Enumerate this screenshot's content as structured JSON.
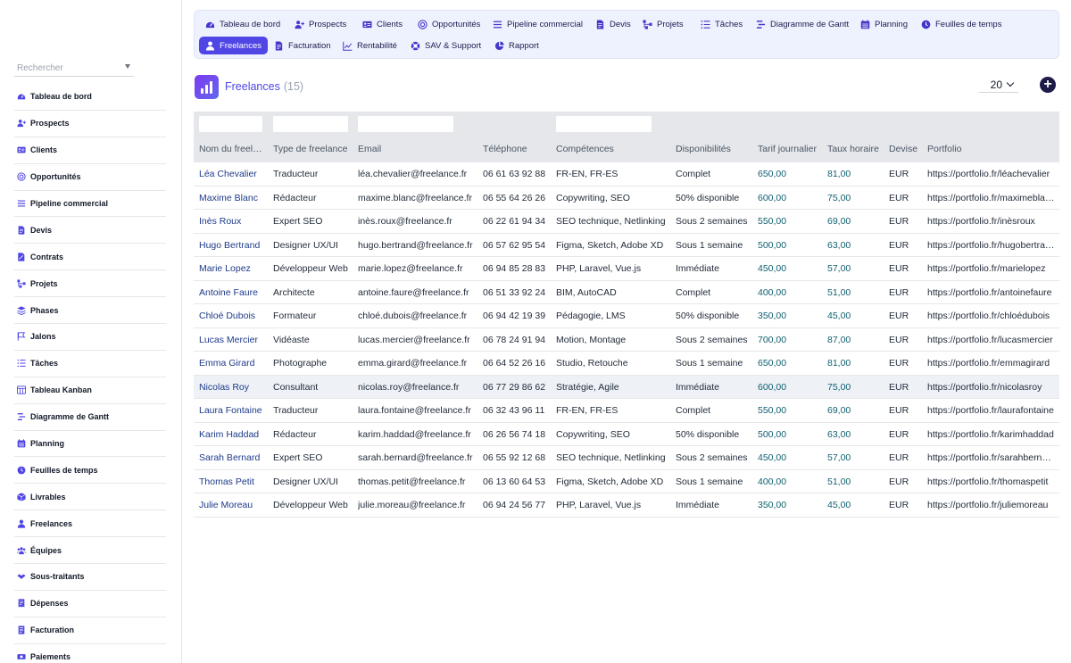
{
  "sidebar": {
    "search_placeholder": "Rechercher",
    "items": [
      {
        "label": "Tableau de bord",
        "icon": "dashboard-icon"
      },
      {
        "label": "Prospects",
        "icon": "user-plus-icon"
      },
      {
        "label": "Clients",
        "icon": "id-card-icon"
      },
      {
        "label": "Opportunités",
        "icon": "target-icon"
      },
      {
        "label": "Pipeline commercial",
        "icon": "bars-icon"
      },
      {
        "label": "Devis",
        "icon": "document-icon"
      },
      {
        "label": "Contrats",
        "icon": "contract-icon"
      },
      {
        "label": "Projets",
        "icon": "project-icon"
      },
      {
        "label": "Phases",
        "icon": "layers-icon"
      },
      {
        "label": "Jalons",
        "icon": "flag-icon"
      },
      {
        "label": "Tâches",
        "icon": "checklist-icon"
      },
      {
        "label": "Tableau Kanban",
        "icon": "kanban-icon"
      },
      {
        "label": "Diagramme de Gantt",
        "icon": "gantt-icon"
      },
      {
        "label": "Planning",
        "icon": "calendar-icon"
      },
      {
        "label": "Feuilles de temps",
        "icon": "clock-icon"
      },
      {
        "label": "Livrables",
        "icon": "box-icon"
      },
      {
        "label": "Freelances",
        "icon": "user-icon"
      },
      {
        "label": "Équipes",
        "icon": "users-icon"
      },
      {
        "label": "Sous-traitants",
        "icon": "handshake-icon"
      },
      {
        "label": "Dépenses",
        "icon": "receipt-icon"
      },
      {
        "label": "Facturation",
        "icon": "invoice-icon"
      },
      {
        "label": "Paiements",
        "icon": "money-icon"
      }
    ]
  },
  "topnav": {
    "items": [
      {
        "label": "Tableau de bord",
        "icon": "dashboard-icon"
      },
      {
        "label": "Prospects",
        "icon": "user-plus-icon"
      },
      {
        "label": "Clients",
        "icon": "id-card-icon"
      },
      {
        "label": "Opportunités",
        "icon": "target-icon"
      },
      {
        "label": "Pipeline commercial",
        "icon": "bars-icon"
      },
      {
        "label": "Devis",
        "icon": "document-icon"
      },
      {
        "label": "Projets",
        "icon": "project-icon"
      },
      {
        "label": "Tâches",
        "icon": "checklist-icon"
      },
      {
        "label": "Diagramme de Gantt",
        "icon": "gantt-icon"
      },
      {
        "label": "Planning",
        "icon": "calendar-icon"
      },
      {
        "label": "Feuilles de temps",
        "icon": "clock-icon"
      },
      {
        "label": "Freelances",
        "icon": "user-icon",
        "active": true
      },
      {
        "label": "Facturation",
        "icon": "document-icon"
      },
      {
        "label": "Rentabilité",
        "icon": "chart-line-icon"
      },
      {
        "label": "SAV & Support",
        "icon": "support-icon"
      },
      {
        "label": "Rapport",
        "icon": "pie-icon"
      }
    ]
  },
  "header": {
    "title": "Freelances",
    "count": "(15)",
    "per_page": "20"
  },
  "colors": {
    "accent": "#4f46e5",
    "name_text": "#1e3a8a",
    "money_text": "#0f5f6e"
  },
  "table": {
    "columns": [
      "Nom du freel…",
      "Type de freelance",
      "Email",
      "Téléphone",
      "Compétences",
      "Disponibilités",
      "Tarif journalier",
      "Taux horaire",
      "Devise",
      "Portfolio"
    ],
    "rows": [
      [
        "Léa Chevalier",
        "Traducteur",
        "léa.chevalier@freelance.fr",
        "06 61 63 92 88",
        "FR-EN, FR-ES",
        "Complet",
        "650,00",
        "81,00",
        "EUR",
        "https://portfolio.fr/léachevalier"
      ],
      [
        "Maxime Blanc",
        "Rédacteur",
        "maxime.blanc@freelance.fr",
        "06 55 64 26 26",
        "Copywriting, SEO",
        "50% disponible",
        "600,00",
        "75,00",
        "EUR",
        "https://portfolio.fr/maximebla…"
      ],
      [
        "Inès Roux",
        "Expert SEO",
        "inès.roux@freelance.fr",
        "06 22 61 94 34",
        "SEO technique, Netlinking",
        "Sous 2 semaines",
        "550,00",
        "69,00",
        "EUR",
        "https://portfolio.fr/inèsroux"
      ],
      [
        "Hugo Bertrand",
        "Designer UX/UI",
        "hugo.bertrand@freelance.fr",
        "06 57 62 95 54",
        "Figma, Sketch, Adobe XD",
        "Sous 1 semaine",
        "500,00",
        "63,00",
        "EUR",
        "https://portfolio.fr/hugobertra…"
      ],
      [
        "Marie Lopez",
        "Développeur Web",
        "marie.lopez@freelance.fr",
        "06 94 85 28 83",
        "PHP, Laravel, Vue.js",
        "Immédiate",
        "450,00",
        "57,00",
        "EUR",
        "https://portfolio.fr/marielopez"
      ],
      [
        "Antoine Faure",
        "Architecte",
        "antoine.faure@freelance.fr",
        "06 51 33 92 24",
        "BIM, AutoCAD",
        "Complet",
        "400,00",
        "51,00",
        "EUR",
        "https://portfolio.fr/antoinefaure"
      ],
      [
        "Chloé Dubois",
        "Formateur",
        "chloé.dubois@freelance.fr",
        "06 94 42 19 39",
        "Pédagogie, LMS",
        "50% disponible",
        "350,00",
        "45,00",
        "EUR",
        "https://portfolio.fr/chloédubois"
      ],
      [
        "Lucas Mercier",
        "Vidéaste",
        "lucas.mercier@freelance.fr",
        "06 78 24 91 94",
        "Motion, Montage",
        "Sous 2 semaines",
        "700,00",
        "87,00",
        "EUR",
        "https://portfolio.fr/lucasmercier"
      ],
      [
        "Emma Girard",
        "Photographe",
        "emma.girard@freelance.fr",
        "06 64 52 26 16",
        "Studio, Retouche",
        "Sous 1 semaine",
        "650,00",
        "81,00",
        "EUR",
        "https://portfolio.fr/emmagirard"
      ],
      [
        "Nicolas Roy",
        "Consultant",
        "nicolas.roy@freelance.fr",
        "06 77 29 86 62",
        "Stratégie, Agile",
        "Immédiate",
        "600,00",
        "75,00",
        "EUR",
        "https://portfolio.fr/nicolasroy"
      ],
      [
        "Laura Fontaine",
        "Traducteur",
        "laura.fontaine@freelance.fr",
        "06 32 43 96 11",
        "FR-EN, FR-ES",
        "Complet",
        "550,00",
        "69,00",
        "EUR",
        "https://portfolio.fr/laurafontaine"
      ],
      [
        "Karim Haddad",
        "Rédacteur",
        "karim.haddad@freelance.fr",
        "06 26 56 74 18",
        "Copywriting, SEO",
        "50% disponible",
        "500,00",
        "63,00",
        "EUR",
        "https://portfolio.fr/karimhaddad"
      ],
      [
        "Sarah Bernard",
        "Expert SEO",
        "sarah.bernard@freelance.fr",
        "06 55 92 12 68",
        "SEO technique, Netlinking",
        "Sous 2 semaines",
        "450,00",
        "57,00",
        "EUR",
        "https://portfolio.fr/sarahbern…"
      ],
      [
        "Thomas Petit",
        "Designer UX/UI",
        "thomas.petit@freelance.fr",
        "06 13 60 64 53",
        "Figma, Sketch, Adobe XD",
        "Sous 1 semaine",
        "400,00",
        "51,00",
        "EUR",
        "https://portfolio.fr/thomaspetit"
      ],
      [
        "Julie Moreau",
        "Développeur Web",
        "julie.moreau@freelance.fr",
        "06 94 24 56 77",
        "PHP, Laravel, Vue.js",
        "Immédiate",
        "350,00",
        "45,00",
        "EUR",
        "https://portfolio.fr/juliemoreau"
      ]
    ]
  }
}
